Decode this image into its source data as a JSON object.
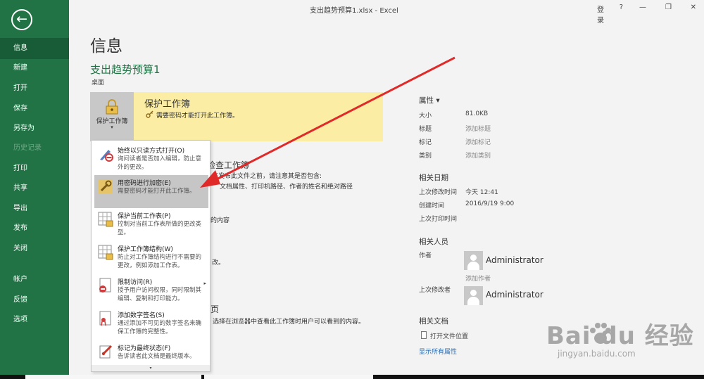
{
  "window": {
    "title": "支出趋势预算1.xlsx - Excel",
    "signin": "登录",
    "help": "?"
  },
  "sidebar": {
    "items": [
      "信息",
      "新建",
      "打开",
      "保存",
      "另存为",
      "历史记录",
      "打印",
      "共享",
      "导出",
      "发布",
      "关闭",
      "帐户",
      "反馈",
      "选项"
    ]
  },
  "main": {
    "heading": "信息",
    "filename": "支出趋势预算1",
    "location": "桌面"
  },
  "protect": {
    "button_label": "保护工作簿",
    "caret": "▾",
    "title": "保护工作簿",
    "desc": "需要密码才能打开此工作簿。"
  },
  "partial_text": [
    "检查工作簿",
    "在发布此文件之前，请注意其是否包含:",
    "文档属性、打印机路径、作者的姓名和绝对路径",
    "的内容",
    "改。",
    "页",
    "选择在浏览器中查看此工作簿时用户可以看到的内容。"
  ],
  "dropdown": {
    "items": [
      {
        "title": "始终以只读方式打开(O)",
        "desc": "询问读者是否加入编辑，防止意外的更改。",
        "icon": "pen-no-icon"
      },
      {
        "title": "用密码进行加密(E)",
        "desc": "需要密码才能打开此工作簿。",
        "icon": "key-lock-icon"
      },
      {
        "title": "保护当前工作表(P)",
        "desc": "控制对当前工作表所做的更改类型。",
        "icon": "sheet-lock-icon"
      },
      {
        "title": "保护工作簿结构(W)",
        "desc": "防止对工作簿结构进行不需要的更改，例如添加工作表。",
        "icon": "workbook-lock-icon"
      },
      {
        "title": "限制访问(R)",
        "desc": "授予用户访问权限，同时限制其编辑、复制和打印能力。",
        "icon": "restrict-icon",
        "arrow": "▸"
      },
      {
        "title": "添加数字签名(S)",
        "desc": "通过添加不可见的数字签名来确保工作簿的完整性。",
        "icon": "signature-icon"
      },
      {
        "title": "标记为最终状态(F)",
        "desc": "告诉读者此文档是最终版本。",
        "icon": "final-icon"
      }
    ],
    "more": "▾"
  },
  "properties": {
    "heading": "属性 ▾",
    "rows": [
      {
        "k": "大小",
        "v": "81.0KB"
      },
      {
        "k": "标题",
        "v": "添加标题"
      },
      {
        "k": "标记",
        "v": "添加标记"
      },
      {
        "k": "类别",
        "v": "添加类别"
      }
    ]
  },
  "dates": {
    "heading": "相关日期",
    "rows": [
      {
        "k": "上次修改时间",
        "v": "今天 12:41"
      },
      {
        "k": "创建时间",
        "v": "2016/9/19 9:00"
      },
      {
        "k": "上次打印时间",
        "v": ""
      }
    ]
  },
  "people": {
    "heading": "相关人员",
    "author_label": "作者",
    "author_name": "Administrator",
    "add_author": "添加作者",
    "modifier_label": "上次修改者",
    "modifier_name": "Administrator"
  },
  "docs": {
    "heading": "相关文档",
    "open_location": "打开文件位置",
    "show_all": "显示所有属性"
  },
  "watermark": {
    "brand": "Bai  du 经验",
    "url": "jingyan.baidu.com"
  },
  "colors": {
    "excel_green": "#217346",
    "active_nav": "#185c37",
    "highlight": "#fbeea4",
    "arrow_red": "#e02a2a"
  }
}
